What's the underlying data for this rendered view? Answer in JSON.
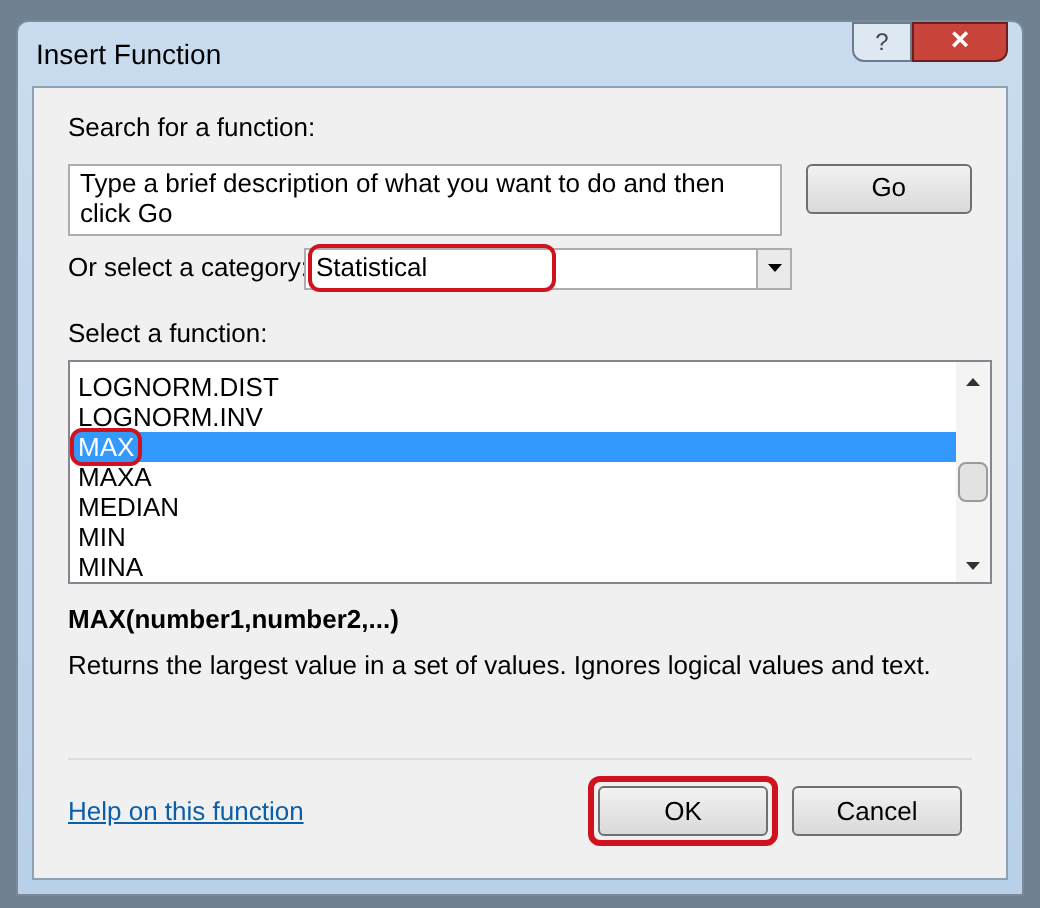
{
  "window": {
    "title": "Insert Function",
    "help_button": "?",
    "close_button": "×"
  },
  "search": {
    "label": "Search for a function:",
    "value": "Type a brief description of what you want to do and then click Go",
    "go_button": "Go"
  },
  "category": {
    "label": "Or select a category:",
    "value": "Statistical",
    "highlighted": true
  },
  "function_list": {
    "label": "Select a function:",
    "items": [
      {
        "name": "LOGNORM.DIST",
        "selected": false,
        "highlighted": false
      },
      {
        "name": "LOGNORM.INV",
        "selected": false,
        "highlighted": false
      },
      {
        "name": "MAX",
        "selected": true,
        "highlighted": true
      },
      {
        "name": "MAXA",
        "selected": false,
        "highlighted": false
      },
      {
        "name": "MEDIAN",
        "selected": false,
        "highlighted": false
      },
      {
        "name": "MIN",
        "selected": false,
        "highlighted": false
      },
      {
        "name": "MINA",
        "selected": false,
        "highlighted": false
      }
    ]
  },
  "signature": "MAX(number1,number2,...)",
  "description": "Returns the largest value in a set of values. Ignores logical values and text.",
  "help_link": "Help on this function",
  "buttons": [
    {
      "label": "OK",
      "highlighted": true
    },
    {
      "label": "Cancel",
      "highlighted": false
    }
  ]
}
